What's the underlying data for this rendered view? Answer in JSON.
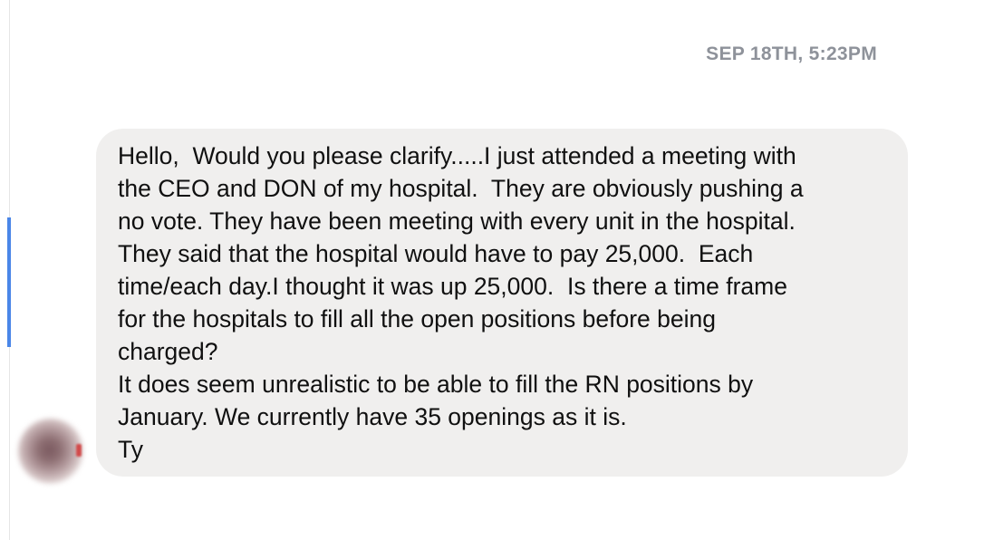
{
  "conversation": {
    "timestamp": "SEP 18TH, 5:23PM",
    "message": {
      "lines": [
        "Hello,  Would you please clarify.....I just attended a meeting with",
        "the CEO and DON of my hospital.  They are obviously pushing a",
        "no vote. They have been meeting with every unit in the hospital.",
        "They said that the hospital would have to pay 25,000.  Each",
        "time/each day.I thought it was up 25,000.  Is there a time frame",
        "for the hospitals to fill all the open positions before being",
        "charged?",
        "It does seem unrealistic to be able to fill the RN positions by",
        "January. We currently have 35 openings as it is.",
        "Ty"
      ]
    }
  },
  "colors": {
    "timestamp": "#8e929a",
    "bubble_background": "#f0efee",
    "scroll_indicator": "#4a86e8",
    "text": "#101010"
  },
  "icons": {
    "avatar": "blurred-profile-avatar"
  }
}
